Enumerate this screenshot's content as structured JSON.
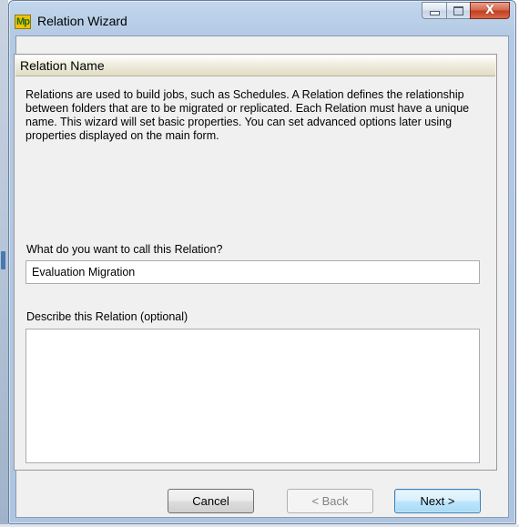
{
  "window": {
    "title": "Relation Wizard",
    "app_icon_text": "Mp",
    "controls": {
      "minimize_icon": "minimize-icon",
      "maximize_icon": "maximize-icon",
      "close_glyph": "X"
    }
  },
  "page": {
    "header": "Relation Name",
    "intro": "Relations are used to build jobs, such as Schedules. A Relation defines the relationship between folders that are to be migrated or replicated. Each Relation must have a unique name.  This wizard will set basic properties. You can set advanced options later using properties displayed on the main form.",
    "name_label": "What do you want to call this Relation?",
    "name_value": "Evaluation Migration",
    "description_label": "Describe this Relation (optional)",
    "description_value": ""
  },
  "buttons": {
    "cancel": "Cancel",
    "back": "< Back",
    "next": "Next >"
  },
  "colors": {
    "title_bar": "#b3c9e4",
    "close_button": "#c23f22",
    "header_band": "#e0dcc4",
    "default_button_border": "#3c7fb1"
  }
}
